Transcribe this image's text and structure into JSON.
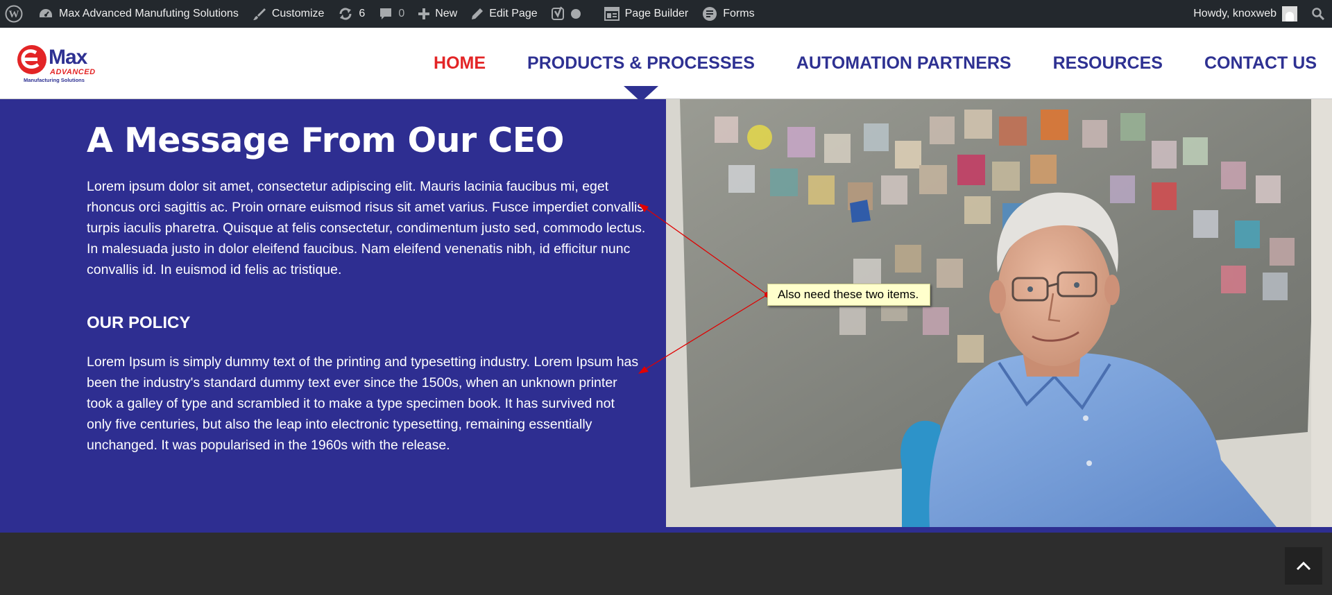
{
  "adminbar": {
    "site_name": "Max Advanced Manufuting Solutions",
    "customize": "Customize",
    "updates_count": "6",
    "comments_count": "0",
    "new": "New",
    "edit_page": "Edit Page",
    "page_builder": "Page Builder",
    "forms": "Forms",
    "howdy": "Howdy, knoxweb"
  },
  "logo": {
    "brand": "Max",
    "subtitle": "ADVANCED",
    "tagline": "Manufacturing Solutions"
  },
  "nav": {
    "items": [
      "HOME",
      "PRODUCTS & PROCESSES",
      "AUTOMATION PARTNERS",
      "RESOURCES",
      "CONTACT US"
    ],
    "active_index": 0
  },
  "main": {
    "title": "A Message From Our CEO",
    "paragraph1": "Lorem ipsum dolor sit amet, consectetur adipiscing elit. Mauris lacinia faucibus mi, eget rhoncus orci sagittis ac. Proin ornare euismod risus sit amet varius. Fusce imperdiet convallis turpis iaculis pharetra. Quisque at felis consectetur, condimentum justo sed, commodo lectus. In malesuada justo in dolor eleifend faucibus. Nam eleifend venenatis nibh, id efficitur nunc convallis id. In euismod id felis ac tristique.",
    "policy_heading": "OUR POLICY",
    "paragraph2": "Lorem Ipsum is simply dummy text of the printing and typesetting industry. Lorem Ipsum has been the industry's standard dummy text ever since the 1500s, when an unknown printer took a galley of type and scrambled it to make a type specimen book. It has survived not only five centuries, but also the leap into electronic typesetting, remaining essentially unchanged. It was popularised in the 1960s with the release."
  },
  "annotation": {
    "note": "Also need these two items."
  },
  "colors": {
    "brand_blue": "#2e3192",
    "brand_red": "#e32526",
    "panel_blue": "#2e2e91",
    "adminbar": "#23282d",
    "footer": "#2d2d2d",
    "note_bg": "#ffffcc",
    "annotation_red": "#e00000"
  },
  "icons": {
    "wordpress": "wordpress-icon",
    "dashboard": "dashboard-icon",
    "customize": "paintbrush-icon",
    "updates": "refresh-icon",
    "comments": "comment-icon",
    "new": "plus-icon",
    "edit": "pencil-icon",
    "seo": "yoast-icon",
    "status": "status-dot-icon",
    "page_builder": "page-builder-icon",
    "forms": "forms-icon",
    "search": "search-icon",
    "back_to_top": "chevron-up-icon"
  }
}
